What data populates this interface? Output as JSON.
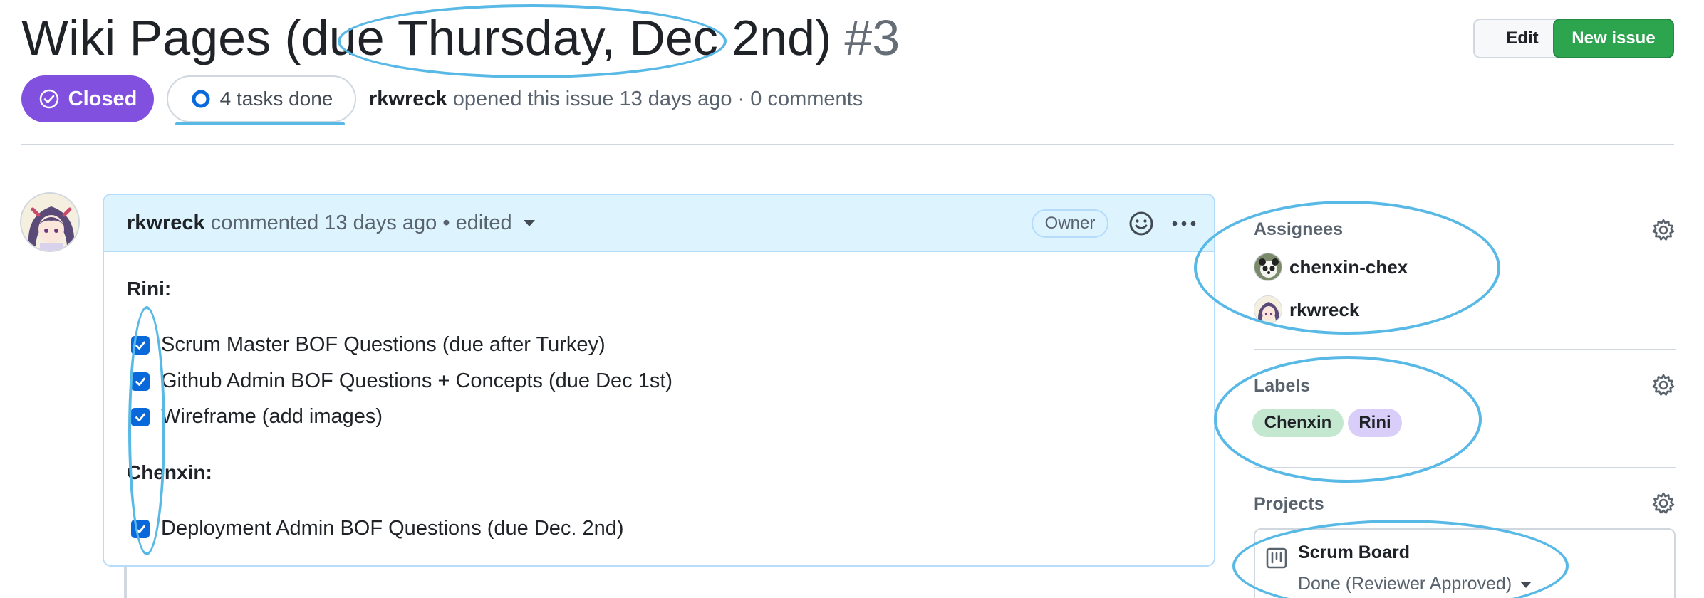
{
  "issue": {
    "title": "Wiki Pages (due Thursday, Dec 2nd)",
    "number": "#3",
    "state": "Closed",
    "tasks": "4 tasks done",
    "author": "rkwreck",
    "opened_text": "opened this issue 13 days ago · 0 comments"
  },
  "header_actions": {
    "edit": "Edit",
    "new_issue": "New issue"
  },
  "comment": {
    "author": "rkwreck",
    "meta": "commented 13 days ago • edited",
    "owner_badge": "Owner",
    "sections": [
      {
        "heading": "Rini:",
        "tasks": [
          {
            "text": "Scrum Master BOF Questions (due after Turkey)",
            "checked": true
          },
          {
            "text": "Github Admin BOF Questions + Concepts (due Dec 1st)",
            "checked": true
          },
          {
            "text": "Wireframe (add images)",
            "checked": true
          }
        ]
      },
      {
        "heading": "Chenxin:",
        "tasks": [
          {
            "text": "Deployment Admin BOF Questions (due Dec. 2nd)",
            "checked": true
          }
        ]
      }
    ]
  },
  "sidebar": {
    "assignees": {
      "title": "Assignees",
      "people": [
        "chenxin-chex",
        "rkwreck"
      ]
    },
    "labels": {
      "title": "Labels",
      "items": [
        {
          "name": "Chenxin",
          "color": "#c3e7cf"
        },
        {
          "name": "Rini",
          "color": "#d9cdf9"
        }
      ]
    },
    "projects": {
      "title": "Projects",
      "board": "Scrum Board",
      "status": "Done (Reviewer Approved)"
    }
  },
  "colors": {
    "closed": "#8250df",
    "new_issue": "#2da44e",
    "checkbox": "#0969da",
    "annotation": "#58b9e6"
  }
}
